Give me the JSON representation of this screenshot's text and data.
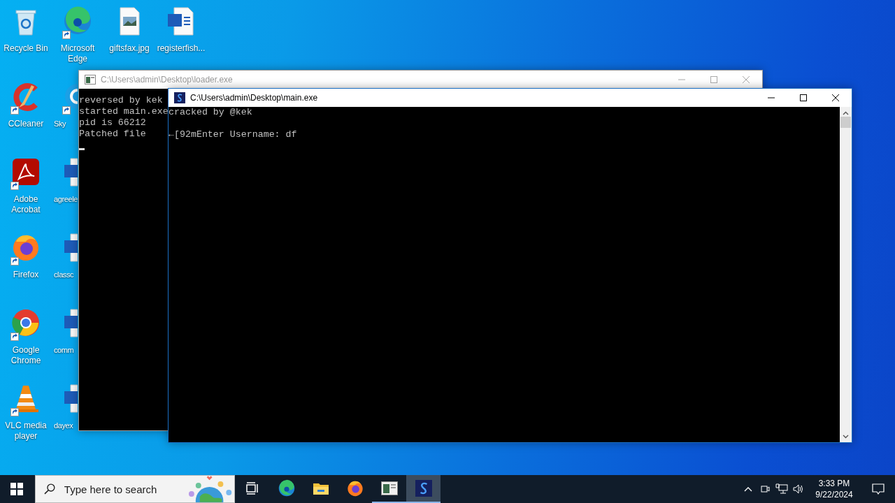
{
  "desktop": {
    "top_row": [
      {
        "label": "Recycle Bin",
        "kind": "recycle",
        "shortcut": false
      },
      {
        "label": "Microsoft Edge",
        "kind": "edge",
        "shortcut": true
      },
      {
        "label": "giftsfax.jpg",
        "kind": "image",
        "shortcut": false
      },
      {
        "label": "registerfish...",
        "kind": "word",
        "shortcut": false
      }
    ],
    "rows": [
      [
        {
          "label": "CCleaner",
          "kind": "ccleaner",
          "shortcut": true
        },
        {
          "label": "Sky",
          "kind": "skype",
          "shortcut": true
        }
      ],
      [
        {
          "label": "Adobe Acrobat",
          "kind": "acrobat",
          "shortcut": true
        },
        {
          "label": "agreele",
          "kind": "word",
          "shortcut": false
        }
      ],
      [
        {
          "label": "Firefox",
          "kind": "firefox",
          "shortcut": true
        },
        {
          "label": "classc",
          "kind": "word",
          "shortcut": false
        }
      ],
      [
        {
          "label": "Google Chrome",
          "kind": "chrome",
          "shortcut": true
        },
        {
          "label": "comm",
          "kind": "word",
          "shortcut": false
        }
      ],
      [
        {
          "label": "VLC media player",
          "kind": "vlc",
          "shortcut": true
        },
        {
          "label": "dayex",
          "kind": "word",
          "shortcut": false
        }
      ]
    ]
  },
  "windows": [
    {
      "title": "C:\\Users\\admin\\Desktop\\loader.exe",
      "active": false,
      "cursor": true,
      "blocks": [
        [
          "reversed by kek",
          "started main.exe",
          "pid is 66212",
          "Patched file"
        ]
      ]
    },
    {
      "title": "C:\\Users\\admin\\Desktop\\main.exe",
      "active": true,
      "cursor": false,
      "blocks": [
        [
          "cracked by @kek"
        ],
        [
          "←[92mEnter Username: df"
        ]
      ]
    }
  ],
  "taskbar": {
    "search": {
      "placeholder": "Type here to search"
    },
    "apps": [
      {
        "kind": "taskview",
        "running": false,
        "selected": false
      },
      {
        "kind": "edge",
        "running": false,
        "selected": false
      },
      {
        "kind": "explorer",
        "running": false,
        "selected": false
      },
      {
        "kind": "firefox",
        "running": false,
        "selected": false
      },
      {
        "kind": "console",
        "running": true,
        "selected": false
      },
      {
        "kind": "app",
        "running": true,
        "selected": true
      }
    ],
    "tray": [
      {
        "kind": "chevron"
      },
      {
        "kind": "camera"
      },
      {
        "kind": "network"
      },
      {
        "kind": "volume"
      }
    ],
    "time": "3:33 PM",
    "date": "9/22/2024"
  }
}
